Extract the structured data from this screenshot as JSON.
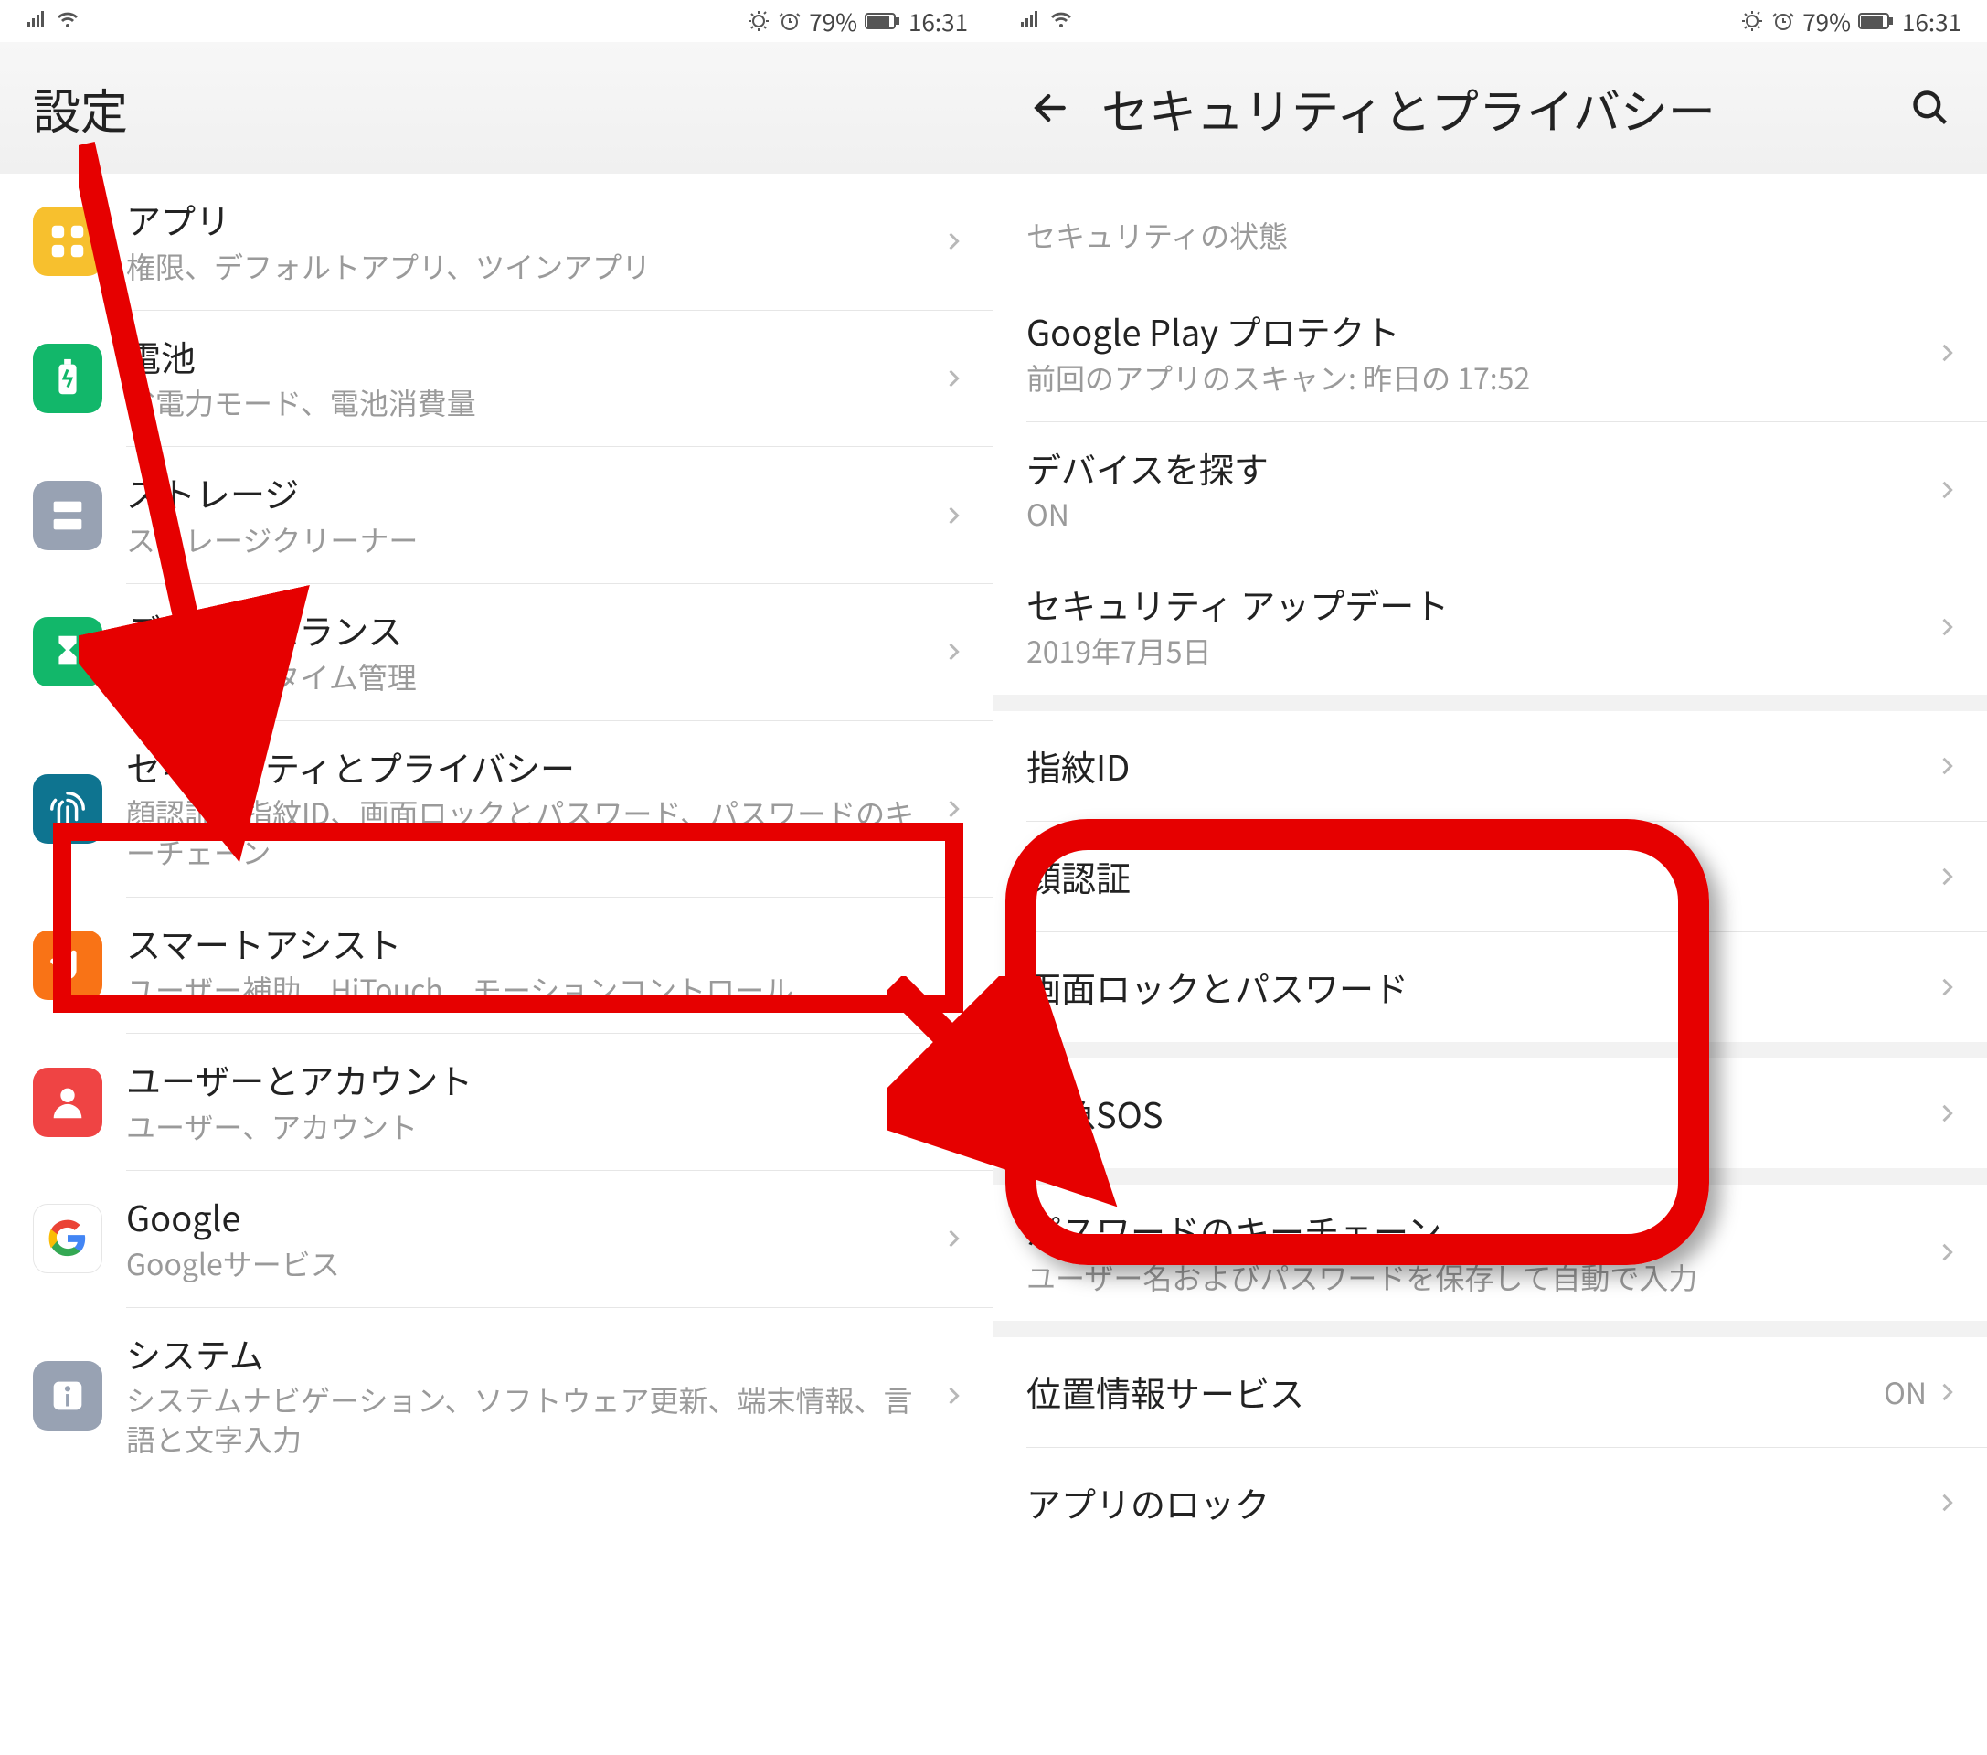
{
  "status": {
    "battery": "79%",
    "time": "16:31"
  },
  "left": {
    "title": "設定",
    "rows": [
      {
        "id": "apps",
        "title": "アプリ",
        "sub": "権限、デフォルトアプリ、ツインアプリ"
      },
      {
        "id": "battery",
        "title": "電池",
        "sub": "省電力モード、電池消費量"
      },
      {
        "id": "storage",
        "title": "ストレージ",
        "sub": "ストレージクリーナー"
      },
      {
        "id": "digital",
        "title": "デジタルバランス",
        "sub": "スクリーンタイム管理"
      },
      {
        "id": "security",
        "title": "セキュリティとプライバシー",
        "sub": "顔認証、指紋ID、画面ロックとパスワード、パスワードのキーチェーン"
      },
      {
        "id": "assist",
        "title": "スマートアシスト",
        "sub": "ユーザー補助、HiTouch、モーションコントロール"
      },
      {
        "id": "user",
        "title": "ユーザーとアカウント",
        "sub": "ユーザー、アカウント"
      },
      {
        "id": "google",
        "title": "Google",
        "sub": "Googleサービス"
      },
      {
        "id": "system",
        "title": "システム",
        "sub": "システムナビゲーション、ソフトウェア更新、端末情報、言語と文字入力"
      }
    ]
  },
  "right": {
    "title": "セキュリティとプライバシー",
    "sectionLabel": "セキュリティの状態",
    "rows": [
      {
        "title": "Google Play プロテクト",
        "sub": "前回のアプリのスキャン: 昨日の 17:52"
      },
      {
        "title": "デバイスを探す",
        "sub": "ON"
      },
      {
        "title": "セキュリティ アップデート",
        "sub": "2019年7月5日"
      },
      {
        "title": "指紋ID"
      },
      {
        "title": "顔認証"
      },
      {
        "title": "画面ロックとパスワード"
      },
      {
        "title": "緊急SOS"
      },
      {
        "title": "パスワードのキーチェーン",
        "sub": "ユーザー名およびパスワードを保存して自動で入力"
      },
      {
        "title": "位置情報サービス",
        "trail": "ON"
      },
      {
        "title": "アプリのロック"
      }
    ]
  }
}
